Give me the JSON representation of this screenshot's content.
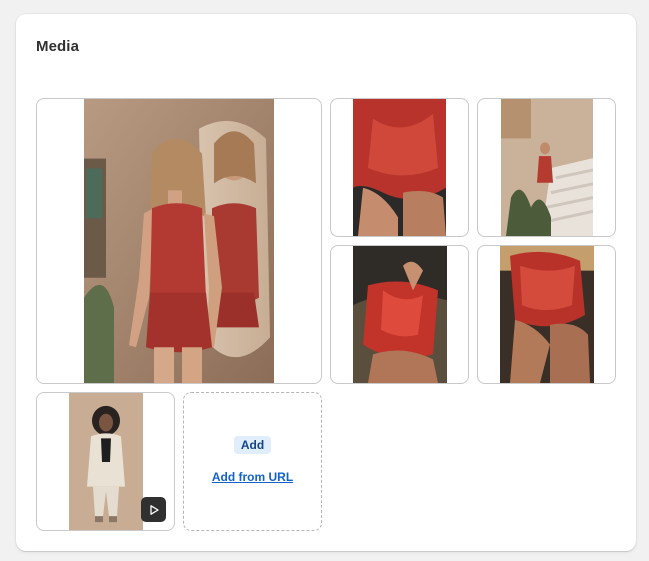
{
  "card": {
    "title": "Media"
  },
  "media": [
    {
      "name": "media-item-featured",
      "alt": "Model in red satin romper leaning on mirror",
      "kind": "image"
    },
    {
      "name": "media-item-2",
      "alt": "Red romper back detail",
      "kind": "image"
    },
    {
      "name": "media-item-3",
      "alt": "Model on stairs with plants",
      "kind": "image"
    },
    {
      "name": "media-item-4",
      "alt": "Red romper close-up seated",
      "kind": "image"
    },
    {
      "name": "media-item-5",
      "alt": "Red romper side view",
      "kind": "image"
    },
    {
      "name": "media-item-6",
      "alt": "Model in cream suit",
      "kind": "video",
      "icon": "play-icon"
    }
  ],
  "dropzone": {
    "add_label": "Add",
    "add_from_url_label": "Add from URL"
  },
  "colors": {
    "card_bg": "#ffffff",
    "page_bg": "#f1f1f1",
    "add_button_bg": "#e0edfb",
    "add_button_text": "#13448a",
    "link": "#1463c8"
  }
}
